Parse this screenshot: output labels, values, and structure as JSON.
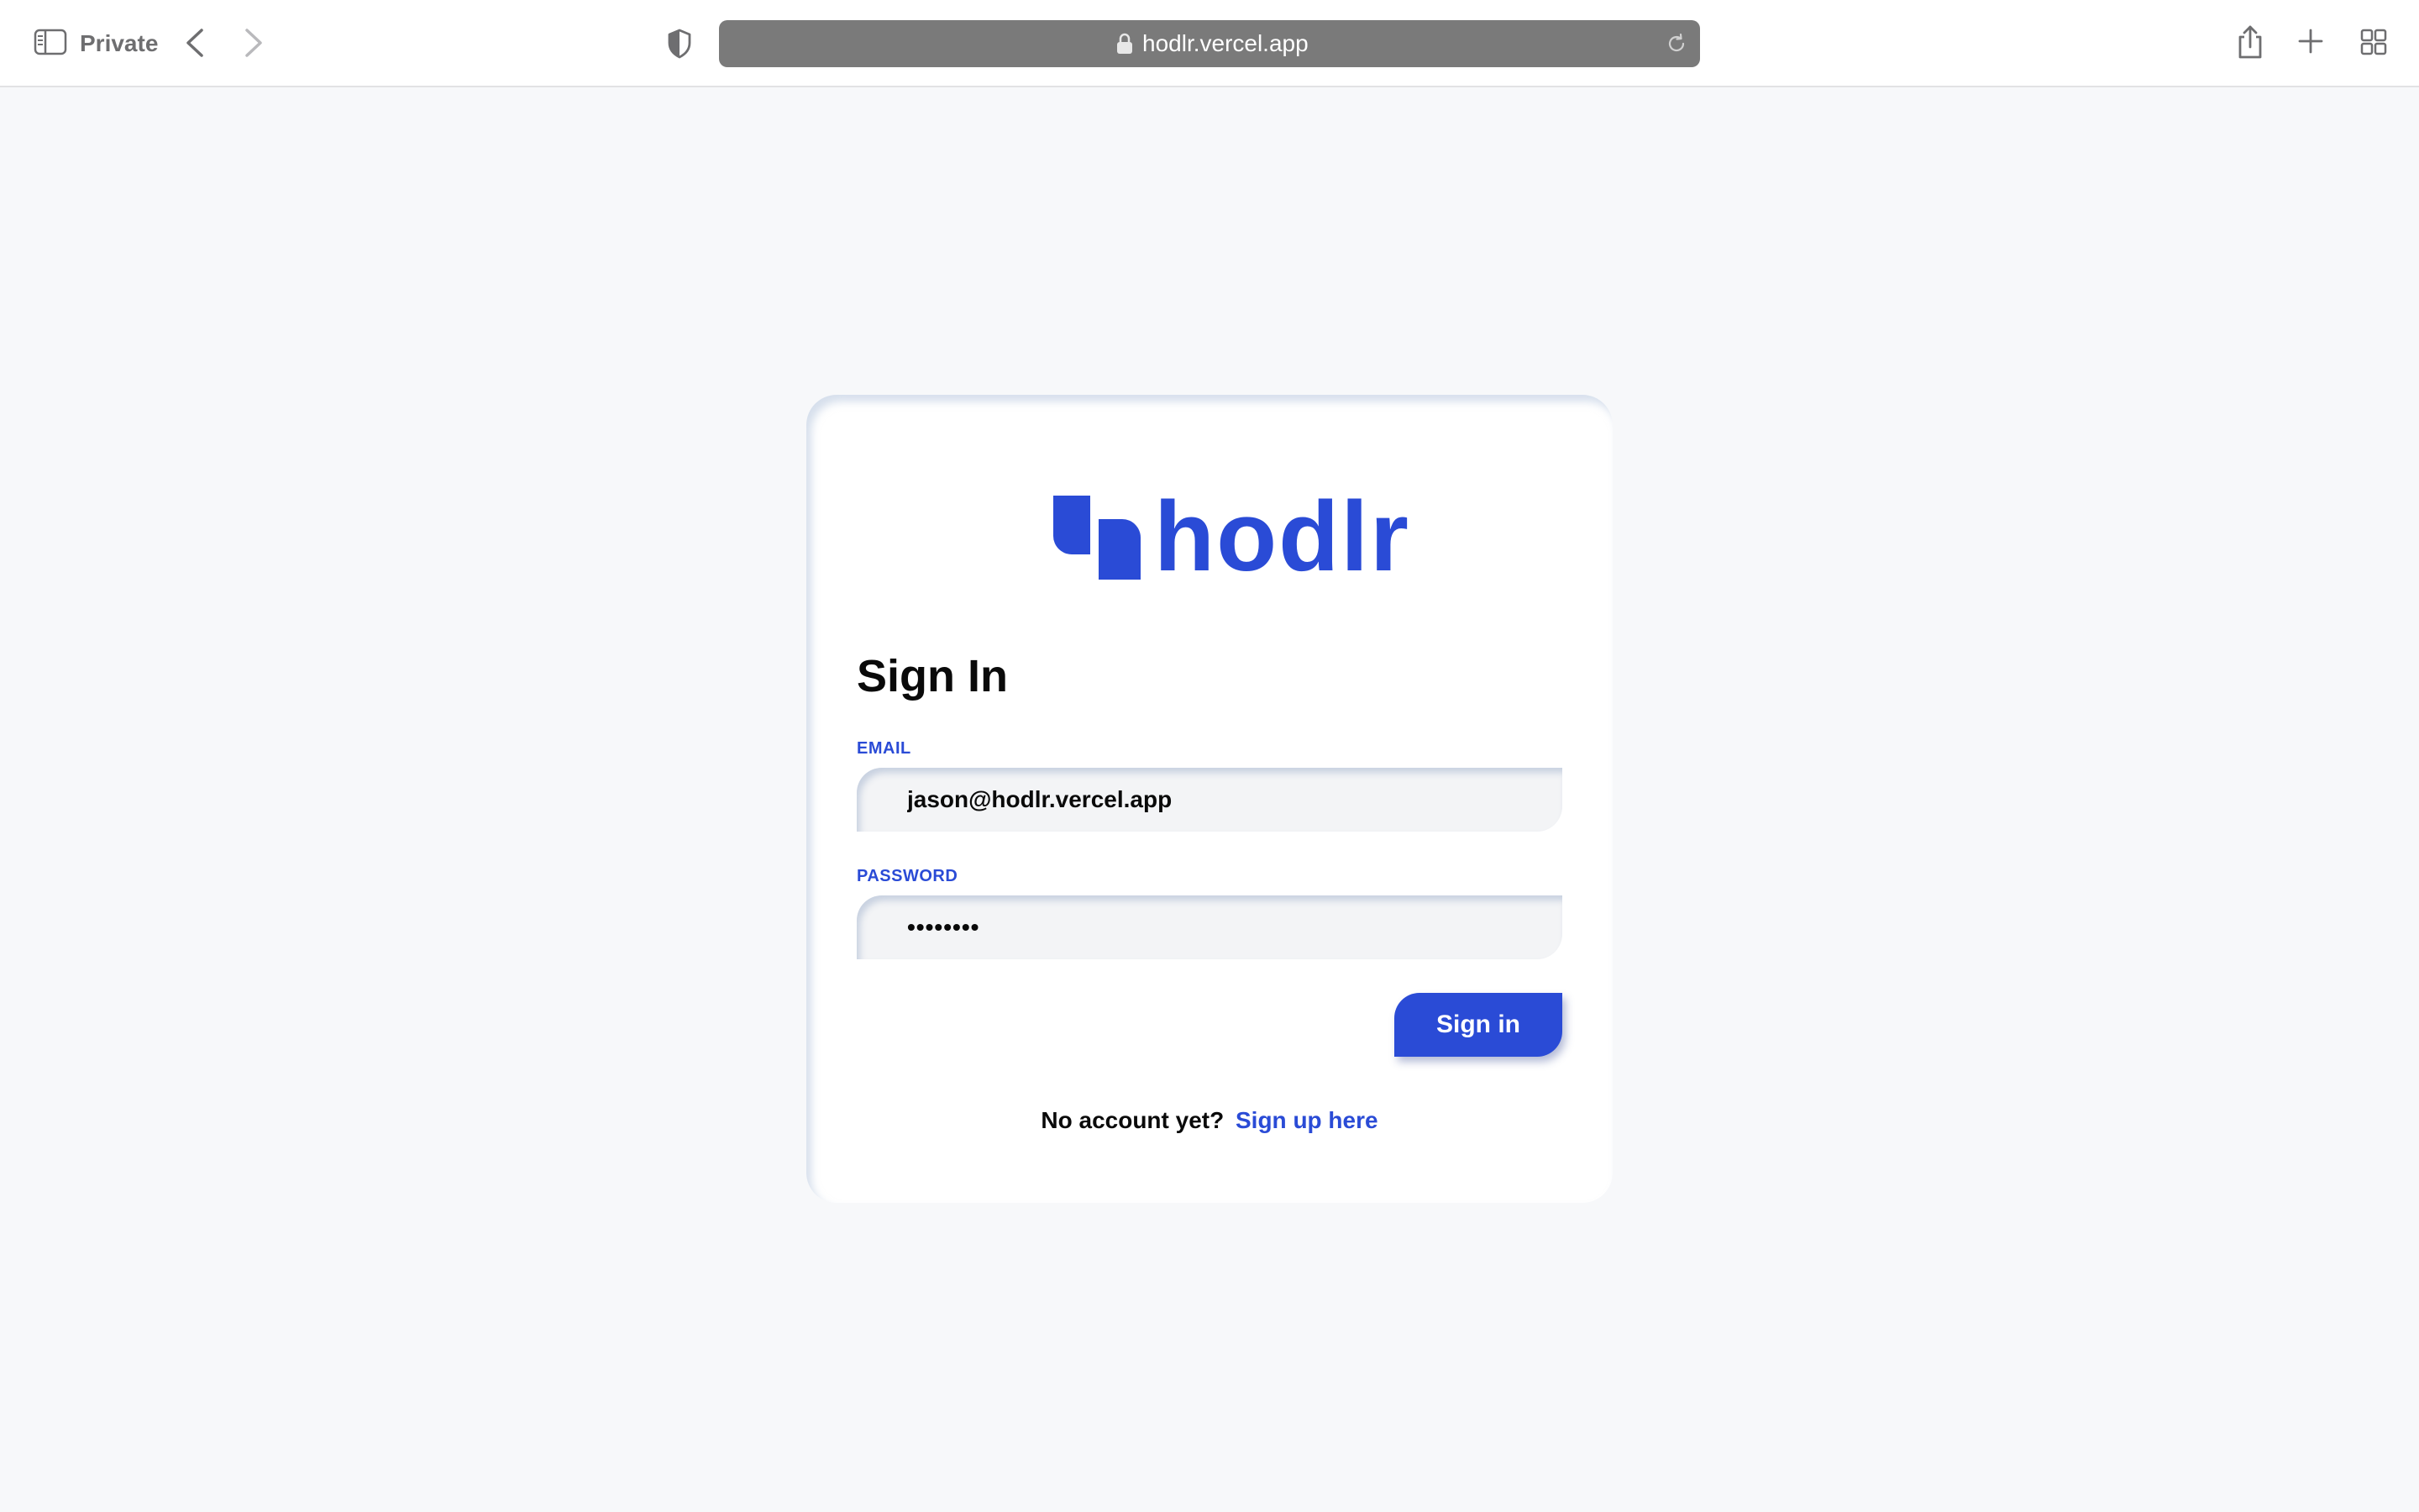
{
  "browser": {
    "window_label": "Private",
    "url": "hodlr.vercel.app",
    "icons": {
      "sidebar": "sidebar-icon",
      "back": "chevron-left-icon",
      "forward": "chevron-right-icon",
      "shield": "shield-icon",
      "lock": "lock-icon",
      "reload": "reload-icon",
      "share": "share-icon",
      "new_tab": "plus-icon",
      "tabs": "tab-overview-icon"
    }
  },
  "brand": {
    "name": "hodlr",
    "color": "#2a4bd6"
  },
  "form": {
    "title": "Sign In",
    "email": {
      "label": "EMAIL",
      "value": "jason@hodlr.vercel.app"
    },
    "password": {
      "label": "PASSWORD",
      "value": "••••••••"
    },
    "submit_label": "Sign in",
    "signup_prompt": "No account yet?",
    "signup_link": "Sign up here"
  }
}
